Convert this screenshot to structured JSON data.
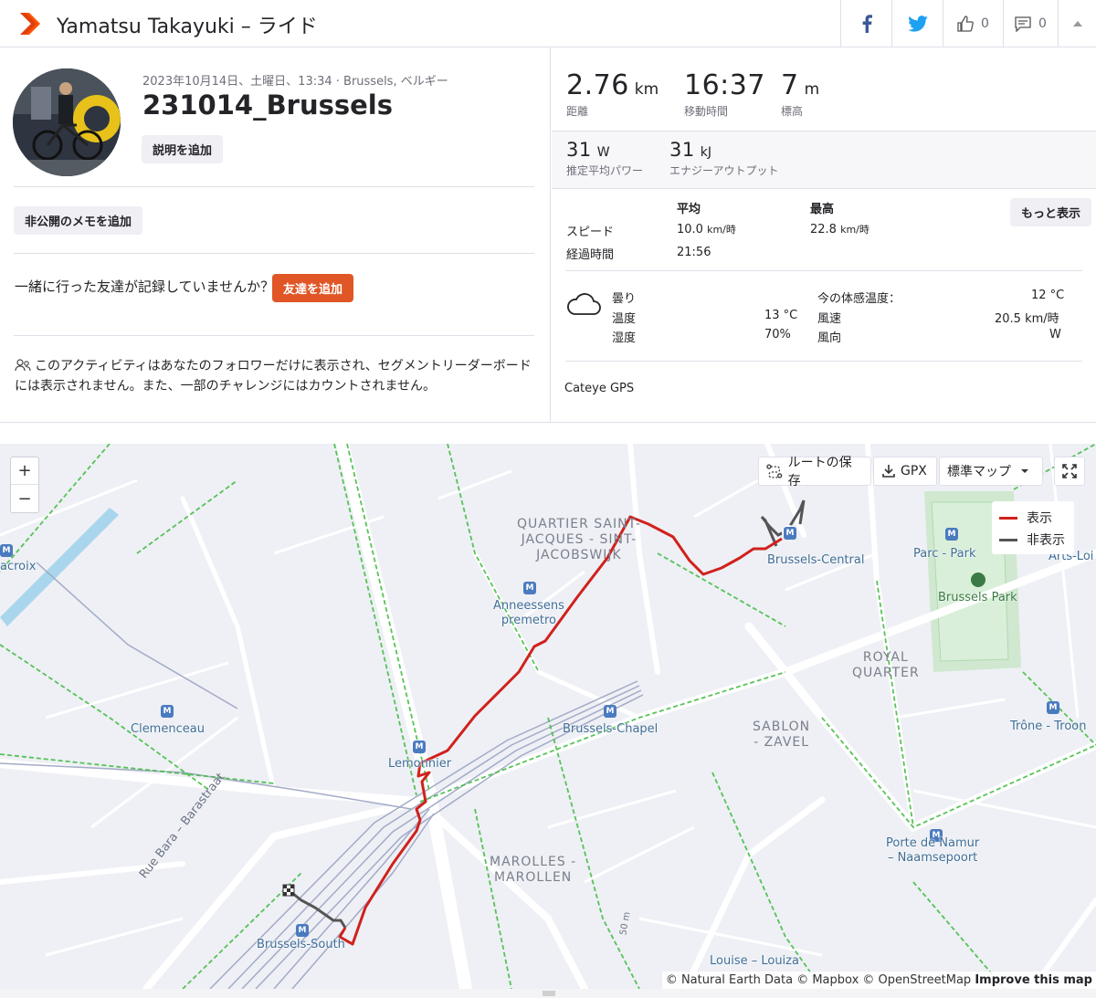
{
  "header": {
    "title": "Yamatsu Takayuki – ライド",
    "kudos_count": "0",
    "comment_count": "0"
  },
  "activity": {
    "date": "2023年10月14日、土曜日、13:34 · Brussels, ベルギー",
    "name": "231014_Brussels",
    "add_description": "説明を追加",
    "add_private_note": "非公開のメモを追加",
    "friend_question": "一緒に行った友達が記録していませんか？",
    "add_friend": "友達を追加",
    "privacy_notice": "このアクティビティはあなたのフォロワーだけに表示され、セグメントリーダーボードには表示されません。また、一部のチャレンジにはカウントされません。"
  },
  "stats": {
    "distance": {
      "value": "2.76",
      "unit": "km",
      "label": "距離"
    },
    "moving_time": {
      "value": "16:37",
      "label": "移動時間"
    },
    "elevation": {
      "value": "7",
      "unit": "m",
      "label": "標高"
    },
    "power": {
      "value": "31",
      "unit": "W",
      "label": "推定平均パワー"
    },
    "energy": {
      "value": "31",
      "unit": "kJ",
      "label": "エナジーアウトプット"
    }
  },
  "more_stats": {
    "col_avg": "平均",
    "col_max": "最高",
    "more_button": "もっと表示",
    "speed_label": "スピード",
    "speed_avg": "10.0",
    "speed_avg_unit": "km/時",
    "speed_max": "22.8",
    "speed_max_unit": "km/時",
    "elapsed_label": "経過時間",
    "elapsed_value": "21:56"
  },
  "weather": {
    "condition": "曇り",
    "temp_label": "温度",
    "temp_value": "13 °C",
    "humidity_label": "湿度",
    "humidity_value": "70%",
    "feels_label": "今の体感温度：",
    "feels_value": "12 °C",
    "wind_speed_label": "風速",
    "wind_speed_value": "20.5 km/時",
    "wind_dir_label": "風向",
    "wind_dir_value": "W"
  },
  "device": "Cateye GPS",
  "map": {
    "zoom_in": "+",
    "zoom_out": "−",
    "save_route": "ルートの保存",
    "gpx": "GPX",
    "map_type": "標準マップ",
    "legend_shown": "表示",
    "legend_hidden": "非表示",
    "attribution_1": "© Natural Earth Data © Mapbox © OpenStreetMap",
    "attribution_2": "Improve this map",
    "labels": {
      "quartier1": "QUARTIER SAINT-",
      "quartier2": "JACQUES - SINT-",
      "quartier3": "JACOBSWIJK",
      "anneessens1": "Anneessens",
      "anneessens2": "premetro",
      "brussels_central": "Brussels-Central",
      "parc": "Parc - Park",
      "arts_loi": "Arts-Loi",
      "brussels_park": "Brussels Park",
      "royal1": "ROYAL",
      "royal2": "QUARTER",
      "clemenceau": "Clemenceau",
      "brussels_chapel": "Brussels-Chapel",
      "sablon1": "SABLON",
      "sablon2": "- ZAVEL",
      "trone": "Trône - Troon",
      "lemonnier": "Lemonnier",
      "marolles1": "MAROLLES -",
      "marolles2": "MAROLLEN",
      "porte1": "Porte de Namur",
      "porte2": "– Naamsepoort",
      "rue_bara": "Rue Bara – Barastraat",
      "brussels_south": "Brussels-South",
      "louise": "Louise – Louiza",
      "croix": "acroix",
      "elev": "50 m"
    }
  },
  "colors": {
    "brand": "#fc5200",
    "route_shown": "#d0211c",
    "route_hidden": "#555555",
    "green_path": "#3bba3b"
  }
}
